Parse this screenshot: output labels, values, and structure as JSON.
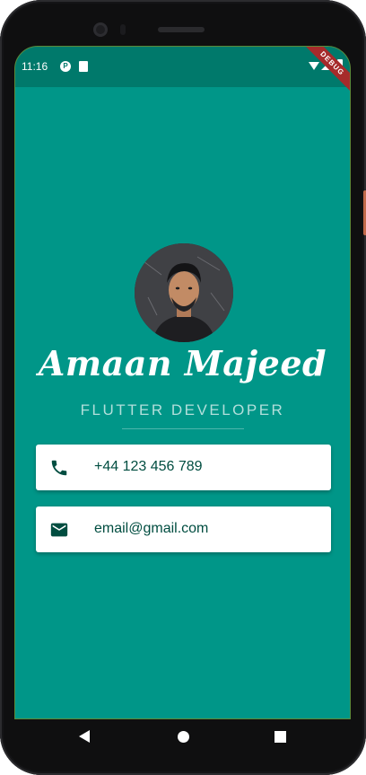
{
  "status_bar": {
    "time": "11:16",
    "p_icon": "P"
  },
  "debug_banner": "DEBUG",
  "profile": {
    "name": "Amaan Majeed",
    "title": "FLUTTER DEVELOPER"
  },
  "contacts": {
    "phone": {
      "icon": "phone-icon",
      "value": "+44 123 456 789"
    },
    "email": {
      "icon": "mail-icon",
      "value": "email@gmail.com"
    }
  },
  "colors": {
    "background": "#009688",
    "status_bar": "#00796b",
    "card_text": "#004d40",
    "subtitle": "#b2dfdb",
    "banner": "#a62b2b"
  }
}
